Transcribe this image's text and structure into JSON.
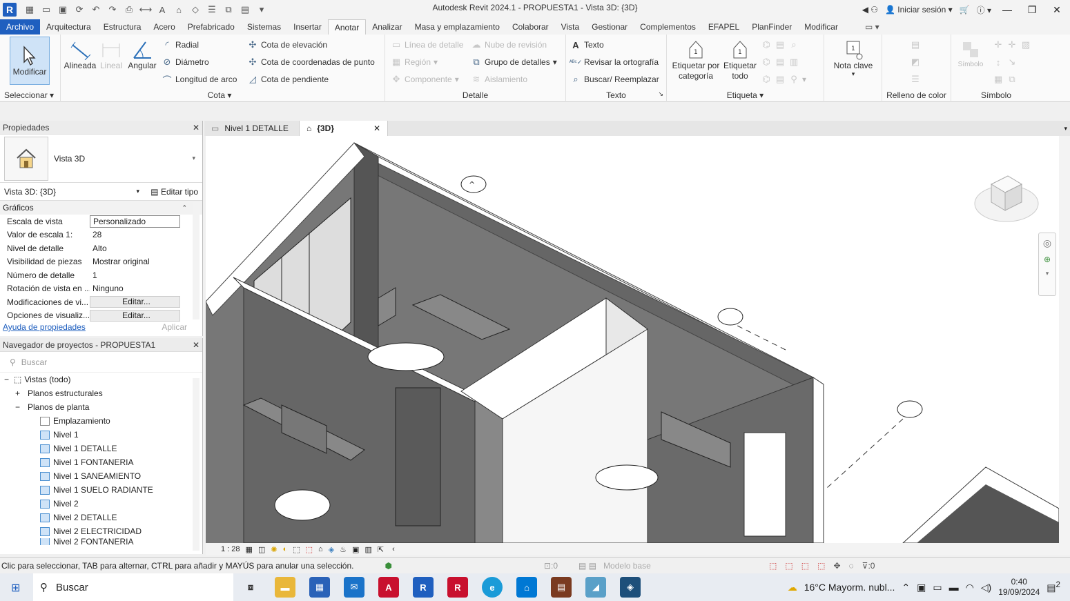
{
  "window": {
    "title": "Autodesk Revit 2024.1 - PROPUESTA1 - Vista 3D: {3D}",
    "sign_in": "Iniciar sesión"
  },
  "tabs": [
    "Archivo",
    "Arquitectura",
    "Estructura",
    "Acero",
    "Prefabricado",
    "Sistemas",
    "Insertar",
    "Anotar",
    "Analizar",
    "Masa y emplazamiento",
    "Colaborar",
    "Vista",
    "Gestionar",
    "Complementos",
    "EFAPEL",
    "PlanFinder",
    "Modificar"
  ],
  "ribbon": {
    "modify": "Modificar",
    "select_label": "Seleccionar",
    "aligned": "Alineada",
    "linear": "Lineal",
    "angular": "Angular",
    "radial": "Radial",
    "diameter": "Diámetro",
    "arc_length": "Longitud  de arco",
    "elev": "Cota de  elevación",
    "coord": "Cota de  coordenadas de punto",
    "slope": "Cota de  pendiente",
    "cota_label": "Cota",
    "detail_line": "Línea de detalle",
    "revision_cloud": "Nube de revisión",
    "region": "Región",
    "detail_group": "Grupo de detalles",
    "component": "Componente",
    "insulation": "Aislamiento",
    "detail_label": "Detalle",
    "text": "Texto",
    "spelling": "Revisar la  ortografía",
    "find_replace": "Buscar/ Reemplazar",
    "text_label": "Texto",
    "tag_by_cat": "Etiquetar por categoría",
    "tag_all": "Etiquetar todo",
    "tag_label": "Etiqueta",
    "keynote": "Nota clave",
    "color_fill": "Relleno de color",
    "symbol": "Símbolo",
    "symbol_label": "Símbolo"
  },
  "properties": {
    "title": "Propiedades",
    "type_name": "Vista 3D",
    "instance": "Vista 3D: {3D}",
    "edit_type": "Editar tipo",
    "section": "Gráficos",
    "rows": [
      {
        "k": "Escala de vista",
        "v": "Personalizado"
      },
      {
        "k": "Valor de escala    1:",
        "v": "28"
      },
      {
        "k": "Nivel de detalle",
        "v": "Alto"
      },
      {
        "k": "Visibilidad de piezas",
        "v": "Mostrar original"
      },
      {
        "k": "Número de detalle",
        "v": "1"
      },
      {
        "k": "Rotación de vista en ...",
        "v": "Ninguno"
      },
      {
        "k": "Modificaciones de vi...",
        "v": "Editar..."
      },
      {
        "k": "Opciones de visualiz...",
        "v": "Editar..."
      }
    ],
    "help": "Ayuda de propiedades",
    "apply": "Aplicar"
  },
  "browser": {
    "title": "Navegador de proyectos - PROPUESTA1",
    "search_placeholder": "Buscar",
    "root": "Vistas (todo)",
    "structural": "Planos estructurales",
    "floor_plans": "Planos de planta",
    "items": [
      "Emplazamiento",
      "Nivel 1",
      "Nivel 1 DETALLE",
      "Nivel 1 FONTANERIA",
      "Nivel 1 SANEAMIENTO",
      "Nivel 1 SUELO RADIANTE",
      "Nivel 2",
      "Nivel 2 DETALLE",
      "Nivel 2 ELECTRICIDAD",
      "Nivel 2 FONTANERIA"
    ]
  },
  "view_tabs": [
    "Nivel 1 DETALLE",
    "{3D}"
  ],
  "viewbar": {
    "scale": "1 : 28"
  },
  "status": {
    "message": "Clic para seleccionar, TAB para alternar, CTRL para añadir y MAYÚS para anular una selección.",
    "workset_count": ":0",
    "model": "Modelo base",
    "filter_count": ":0"
  },
  "taskbar": {
    "search": "Buscar",
    "weather": "16°C  Mayorm. nubl...",
    "time": "0:40",
    "date": "19/09/2024",
    "notif": "2"
  },
  "colors": {
    "accent": "#1f5fbf",
    "select_bg": "#cfe3f7"
  }
}
